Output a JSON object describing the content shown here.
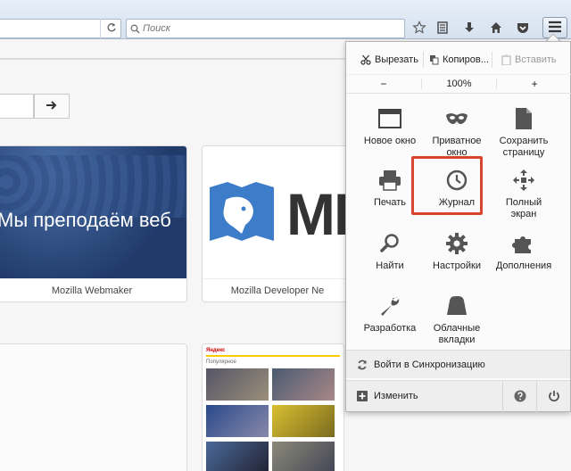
{
  "toolbar": {
    "search_placeholder": "Поиск",
    "icons": [
      "reload-icon",
      "search-icon",
      "bookmark-star-icon",
      "reading-list-icon",
      "download-icon",
      "home-icon",
      "pocket-icon",
      "hamburger-menu-icon"
    ]
  },
  "page": {
    "tiles": [
      {
        "caption": "Mozilla Webmaker",
        "image_text": "Мы преподаём веб"
      },
      {
        "caption": "Mozilla Developer Ne",
        "image_text": "MD"
      }
    ],
    "yandex": {
      "brand": "Яндекс",
      "sub": "Популярное"
    }
  },
  "menu": {
    "edit": {
      "cut": "Вырезать",
      "copy": "Копиров...",
      "paste": "Вставить"
    },
    "zoom": {
      "minus": "−",
      "value": "100%",
      "plus": "+"
    },
    "items": [
      {
        "label": "Новое окно",
        "icon": "new-window-icon"
      },
      {
        "label": "Приватное окно",
        "icon": "private-mask-icon"
      },
      {
        "label": "Сохранить страницу",
        "icon": "save-page-icon"
      },
      {
        "label": "Печать",
        "icon": "printer-icon"
      },
      {
        "label": "Журнал",
        "icon": "history-clock-icon"
      },
      {
        "label": "Полный экран",
        "icon": "fullscreen-icon"
      },
      {
        "label": "Найти",
        "icon": "find-magnifier-icon"
      },
      {
        "label": "Настройки",
        "icon": "settings-gear-icon"
      },
      {
        "label": "Дополнения",
        "icon": "addons-puzzle-icon"
      },
      {
        "label": "Разработка",
        "icon": "developer-wrench-icon"
      },
      {
        "label": "Облачные вкладки",
        "icon": "cloud-tabs-icon"
      }
    ],
    "sync_label": "Войти в Синхронизацию",
    "customize_label": "Изменить"
  }
}
